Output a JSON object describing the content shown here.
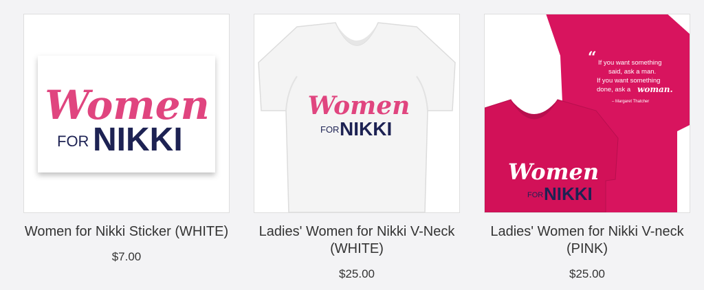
{
  "products": [
    {
      "title": "Women for Nikki Sticker (WHITE)",
      "price": "$7.00",
      "art": {
        "script": "Women",
        "for": "FOR",
        "name": "NIKKI"
      }
    },
    {
      "title": "Ladies' Women for Nikki V-Neck (WHITE)",
      "price": "$25.00",
      "art": {
        "script": "Women",
        "for": "FOR",
        "name": "NIKKI"
      }
    },
    {
      "title": "Ladies' Women for Nikki V-neck (PINK)",
      "price": "$25.00",
      "art": {
        "script": "Women",
        "for": "FOR",
        "name": "NIKKI",
        "quote_line1": "If you want something",
        "quote_line2": "said, ask a man.",
        "quote_line3": "If you want something",
        "quote_line4": "done, ask a",
        "quote_word": "woman.",
        "quote_attrib": "– Margaret Thatcher"
      }
    }
  ],
  "colors": {
    "pink": "#e0457f",
    "navy": "#1d2253",
    "shirt_pink": "#d8145e",
    "shirt_white": "#f5f5f5"
  }
}
